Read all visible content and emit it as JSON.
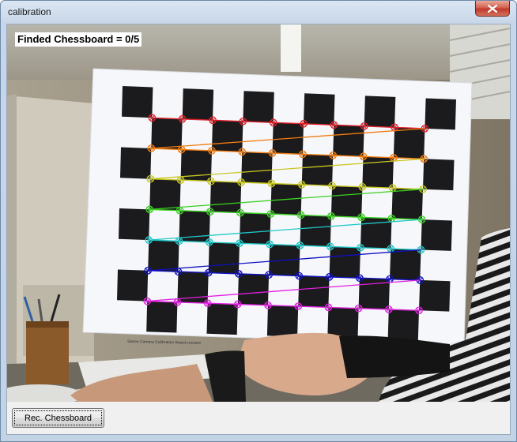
{
  "window": {
    "title": "calibration"
  },
  "overlay": {
    "status_text": "Finded Chessboard = 0/5"
  },
  "board": {
    "caption": "Stereo Camera Calibration Board consent",
    "rows": 7,
    "cols": 10
  },
  "colors": {
    "row_lines": [
      "#e0202a",
      "#f07c10",
      "#c8c820",
      "#3ad020",
      "#20c8c8",
      "#1010c0",
      "#e020e0"
    ]
  },
  "buttons": {
    "rec_chessboard": "Rec. Chessboard"
  }
}
